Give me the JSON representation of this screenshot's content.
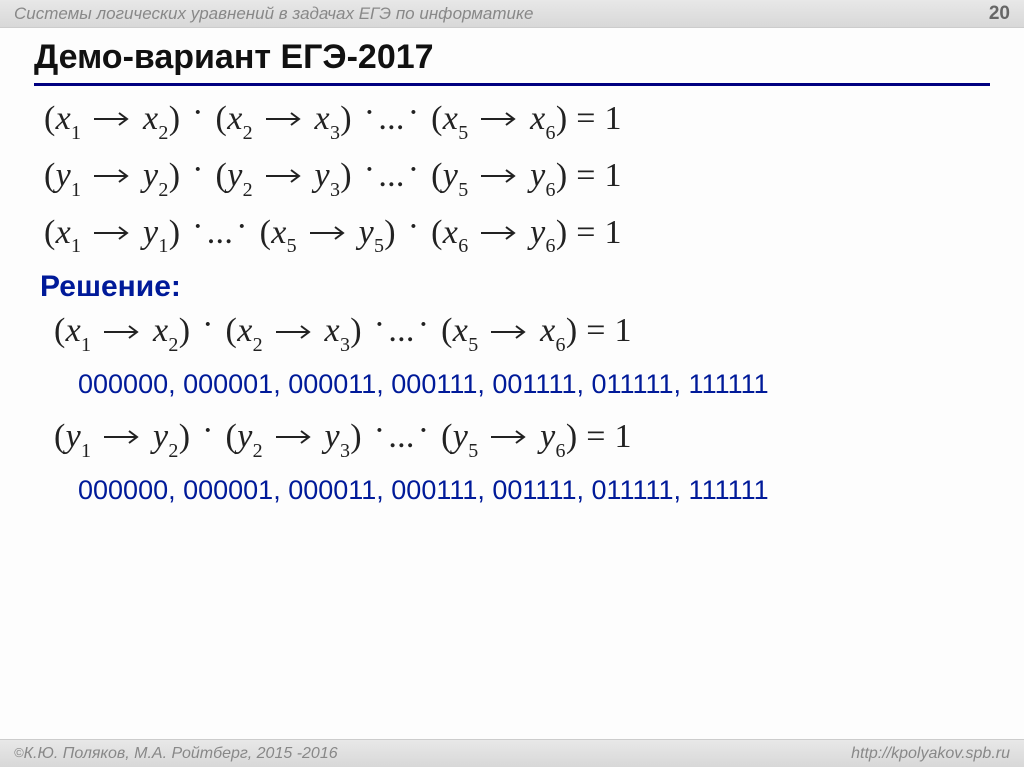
{
  "header": {
    "topic": "Системы логических уравнений в задачах ЕГЭ по информатике",
    "page_number": "20"
  },
  "title": "Демо-вариант ЕГЭ-2017",
  "equations": {
    "eq1": {
      "v": "x",
      "a1": "1",
      "a2": "2",
      "b1": "2",
      "b2": "3",
      "c1": "5",
      "c2": "6",
      "rhs": "1"
    },
    "eq2": {
      "v": "y",
      "a1": "1",
      "a2": "2",
      "b1": "2",
      "b2": "3",
      "c1": "5",
      "c2": "6",
      "rhs": "1"
    },
    "eq3": {
      "vL": "x",
      "vR": "y",
      "a": "1",
      "c": "5",
      "d": "6",
      "rhs": "1"
    }
  },
  "solution": {
    "label": "Решение:",
    "eq1": {
      "v": "x",
      "a1": "1",
      "a2": "2",
      "b1": "2",
      "b2": "3",
      "c1": "5",
      "c2": "6",
      "rhs": "1"
    },
    "answers1": "000000, 000001, 000011, 000111, 001111, 011111, 111111",
    "eq2": {
      "v": "y",
      "a1": "1",
      "a2": "2",
      "b1": "2",
      "b2": "3",
      "c1": "5",
      "c2": "6",
      "rhs": "1"
    },
    "answers2": "000000, 000001, 000011, 000111, 001111, 011111, 111111"
  },
  "footer": {
    "copyright_symbol": "©",
    "authors": "К.Ю. Поляков, М.А. Ройтберг, 2015 -2016",
    "url": "http://kpolyakov.spb.ru"
  }
}
